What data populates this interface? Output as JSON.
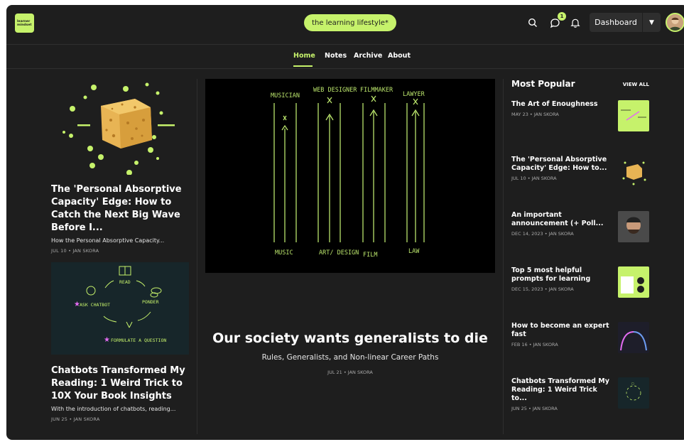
{
  "brand": {
    "logo_text": [
      "learner",
      "mindset"
    ],
    "tagline": "the learning lifestyle*"
  },
  "header": {
    "notification_count": "1",
    "dashboard_label": "Dashboard",
    "icons": [
      "search-icon",
      "chat-icon",
      "bell-icon",
      "chevron-down-icon"
    ]
  },
  "nav": {
    "items": [
      "Home",
      "Notes",
      "Archive",
      "About"
    ],
    "active": "Home"
  },
  "left_cards": [
    {
      "title": "The 'Personal Absorptive Capacity' Edge: How to Catch the Next Big Wave Before I...",
      "subtitle": "How the Personal Absorptive Capacity...",
      "meta": "JUL 10 • JAN SKORA"
    },
    {
      "title": "Chatbots Transformed My Reading: 1 Weird Trick to 10X Your Book Insights",
      "subtitle": "With the introduction of chatbots, reading...",
      "meta": "JUN 25 • JAN SKORA"
    }
  ],
  "hero": {
    "title": "Our society wants generalists to die",
    "subtitle": "Rules, Generalists, and Non-linear Career Paths",
    "meta": "JUL 21 • JAN SKORA",
    "sketch_top": [
      "MUSICIAN",
      "WEB DESIGNER",
      "FILMMAKER",
      "LAWYER"
    ],
    "sketch_bottom": [
      "MUSIC",
      "ART/ DESIGN",
      "FILM",
      "LAW"
    ]
  },
  "chatbot_sketch": [
    "READ",
    "PONDER",
    "FORMULATE A QUESTION",
    "ASK CHATBOT"
  ],
  "sidebar": {
    "heading": "Most Popular",
    "view_all": "VIEW ALL",
    "items": [
      {
        "title": "The Art of Enoughness",
        "meta": "MAY 23 • JAN SKORA"
      },
      {
        "title": "The 'Personal Absorptive Capacity' Edge: How to...",
        "meta": "JUL 10 • JAN SKORA"
      },
      {
        "title": "An important announcement (+ Poll...",
        "meta": "DEC 14, 2023 • JAN SKORA"
      },
      {
        "title": "Top 5 most helpful prompts for learning",
        "meta": "DEC 15, 2023 • JAN SKORA"
      },
      {
        "title": "How to become an expert fast",
        "meta": "FEB 16 • JAN SKORA"
      },
      {
        "title": "Chatbots Transformed My Reading: 1 Weird Trick to...",
        "meta": "JUN 25 • JAN SKORA"
      }
    ]
  },
  "colors": {
    "accent": "#c6f26b",
    "background": "#1e1e1e",
    "sketch": "#b9e36b"
  }
}
